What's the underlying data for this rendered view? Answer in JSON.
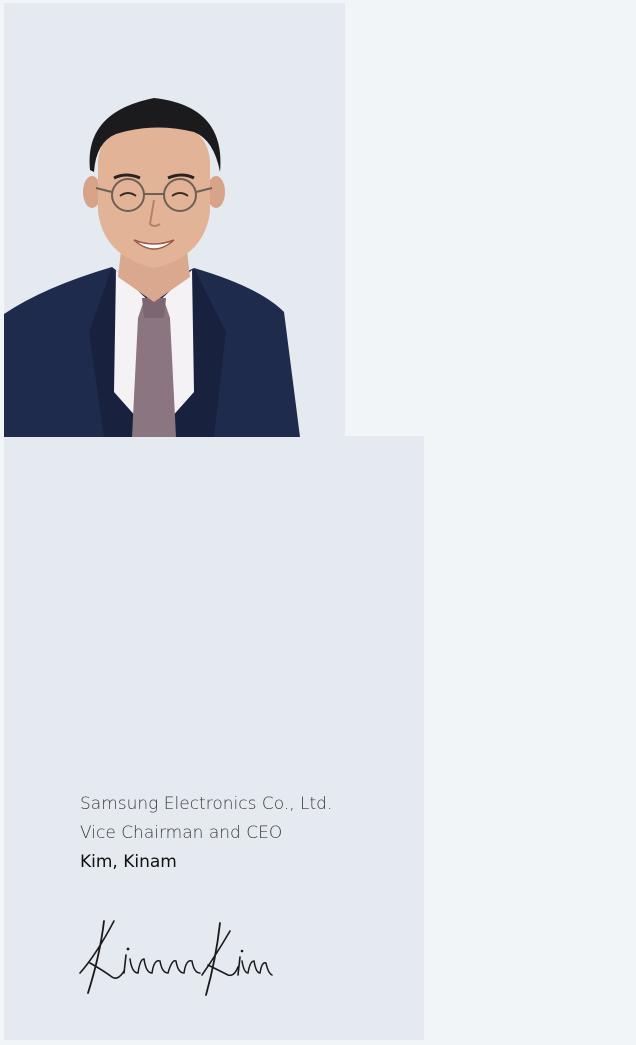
{
  "caption": {
    "company": "Samsung Electronics Co., Ltd.",
    "title": "Vice Chairman and CEO",
    "name": "Kim, Kinam"
  },
  "signature": {
    "text": "Kinam Kim"
  },
  "colors": {
    "background": "#f1f5f8",
    "panel": "#e5eaf0",
    "suit": "#1e2a4a",
    "tie": "#8a7580"
  }
}
